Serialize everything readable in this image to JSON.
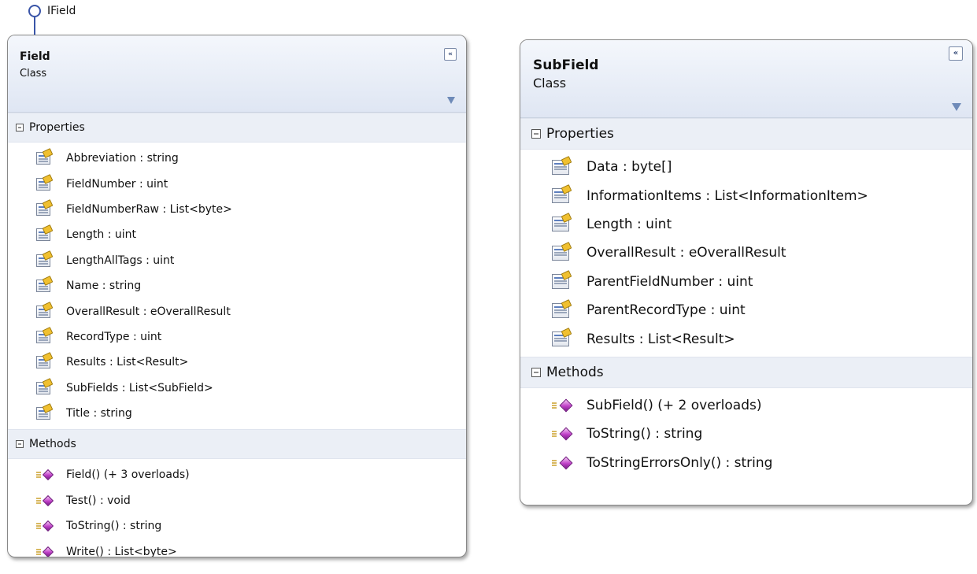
{
  "interface": {
    "name": "IField"
  },
  "classes": [
    {
      "name": "Field",
      "stereotype": "Class",
      "collapse_glyph": "«",
      "sections": [
        {
          "title": "Properties",
          "kind": "property",
          "members": [
            "Abbreviation : string",
            "FieldNumber : uint",
            "FieldNumberRaw : List<byte>",
            "Length : uint",
            "LengthAllTags : uint",
            "Name : string",
            "OverallResult : eOverallResult",
            "RecordType : uint",
            "Results : List<Result>",
            "SubFields : List<SubField>",
            "Title : string"
          ]
        },
        {
          "title": "Methods",
          "kind": "method",
          "members": [
            "Field() (+ 3 overloads)",
            "Test() : void",
            "ToString() : string",
            "Write() : List<byte>"
          ]
        }
      ]
    },
    {
      "name": "SubField",
      "stereotype": "Class",
      "collapse_glyph": "«",
      "sections": [
        {
          "title": "Properties",
          "kind": "property",
          "members": [
            "Data : byte[]",
            "InformationItems : List<InformationItem>",
            "Length : uint",
            "OverallResult : eOverallResult",
            "ParentFieldNumber : uint",
            "ParentRecordType : uint",
            "Results : List<Result>"
          ]
        },
        {
          "title": "Methods",
          "kind": "method",
          "members": [
            "SubField() (+ 2 overloads)",
            "ToString() : string",
            "ToStringErrorsOnly() : string"
          ]
        }
      ]
    }
  ],
  "colors": {
    "header_gradient_top": "#f4f7fc",
    "header_gradient_bottom": "#dfe6f3",
    "section_header": "#ebeff6",
    "interface_line": "#3a55a8"
  },
  "icons": {
    "property": "property-icon",
    "method": "method-icon",
    "collapse": "collapse-chevrons-icon",
    "filter": "filter-icon",
    "section_toggle": "section-collapse-icon"
  }
}
